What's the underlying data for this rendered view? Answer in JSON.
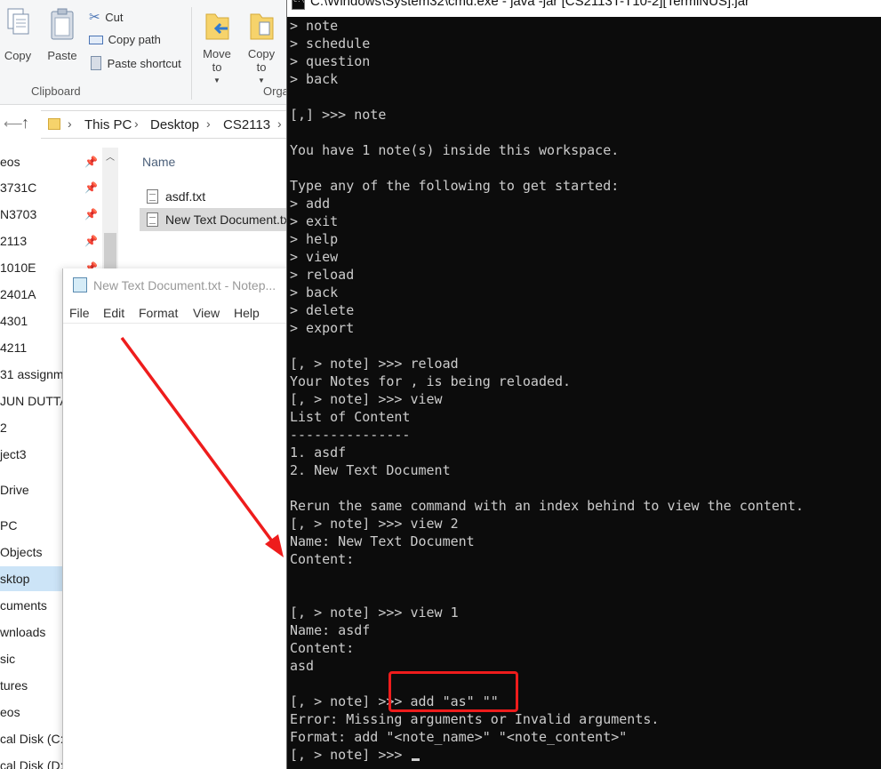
{
  "explorer": {
    "ribbon": {
      "copy_label": "Copy",
      "paste_label": "Paste",
      "cut_label": "Cut",
      "copy_path_label": "Copy path",
      "paste_shortcut_label": "Paste shortcut",
      "clipboard_group": "Clipboard",
      "move_to_label": "Move to",
      "copy_to_label": "Copy to",
      "organize_group": "Orga"
    },
    "breadcrumb": [
      "This PC",
      "Desktop",
      "CS2113"
    ],
    "nav_items": [
      "eos",
      "3731C",
      "N3703",
      "2113",
      "1010E",
      "2401A",
      "4301",
      "4211",
      "31 assignme",
      "JUN DUTTA",
      "2",
      "ject3",
      "Drive",
      "PC",
      "Objects",
      "sktop",
      "cuments",
      "wnloads",
      "sic",
      "tures",
      "eos",
      "cal Disk (C:)",
      "cal Disk (D:"
    ],
    "column_header": "Name",
    "files": [
      "asdf.txt",
      "New Text Document.txt"
    ]
  },
  "notepad": {
    "title": "New Text Document.txt - Notep...",
    "menu": [
      "File",
      "Edit",
      "Format",
      "View",
      "Help"
    ]
  },
  "console": {
    "title": "C:\\Windows\\System32\\cmd.exe - java -jar [CS2113T-T10-2][TermiNUS].jar",
    "lines": [
      "> note",
      "> schedule",
      "> question",
      "> back",
      "",
      "[,] >>> note",
      "",
      "You have 1 note(s) inside this workspace.",
      "",
      "Type any of the following to get started:",
      "> add",
      "> exit",
      "> help",
      "> view",
      "> reload",
      "> back",
      "> delete",
      "> export",
      "",
      "[, > note] >>> reload",
      "Your Notes for , is being reloaded.",
      "[, > note] >>> view",
      "List of Content",
      "---------------",
      "1. asdf",
      "2. New Text Document",
      "",
      "Rerun the same command with an index behind to view the content.",
      "[, > note] >>> view 2",
      "Name: New Text Document",
      "Content:",
      "",
      "",
      "[, > note] >>> view 1",
      "Name: asdf",
      "Content:",
      "asd",
      "",
      "[, > note] >>> add \"as\" \"\"",
      "Error: Missing arguments or Invalid arguments.",
      "Format: add \"<note_name>\" \"<note_content>\"",
      "[, > note] >>> "
    ]
  },
  "colors": {
    "console_bg": "#0c0c0c",
    "console_text": "#cccccc",
    "annotation_red": "#ee1c1c"
  }
}
